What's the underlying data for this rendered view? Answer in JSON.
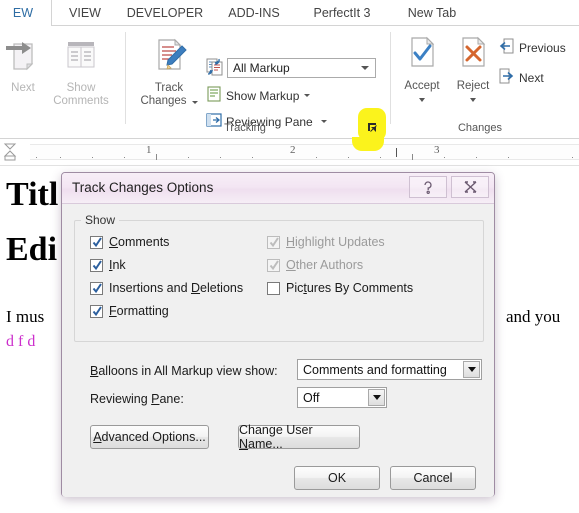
{
  "app": {
    "ribbon_tabs": [
      {
        "label": "EW",
        "active": true
      },
      {
        "label": "VIEW",
        "active": false
      },
      {
        "label": "DEVELOPER",
        "active": false
      },
      {
        "label": "ADD-INS",
        "active": false
      },
      {
        "label": "PerfectIt 3",
        "active": false
      },
      {
        "label": "New Tab",
        "active": false
      }
    ],
    "groups": {
      "comments": {
        "buttons": [
          {
            "label": "Next",
            "icon": "next-comment-icon",
            "disabled": true
          },
          {
            "label": "Show\nComments",
            "line1": "Show",
            "line2": "Comments",
            "icon": "show-comments-icon",
            "disabled": true
          }
        ]
      },
      "tracking": {
        "label": "Tracking",
        "track_changes": {
          "line1": "Track",
          "line2": "Changes",
          "icon": "track-changes-icon",
          "has_dropdown": true
        },
        "display_for_review": {
          "value": "All Markup",
          "icon": "display-for-review-icon"
        },
        "show_markup": {
          "label": "Show Markup",
          "icon": "show-markup-icon",
          "has_dropdown": true
        },
        "reviewing_pane": {
          "label": "Reviewing Pane",
          "icon": "reviewing-pane-icon",
          "has_dropdown": true
        },
        "dialog_launcher": {
          "name": "tracking-dialog-launcher",
          "highlighted": true,
          "highlight_color": "#fbf31c"
        }
      },
      "changes": {
        "label": "Changes",
        "accept": {
          "label": "Accept",
          "icon": "accept-change-icon",
          "accent": "#3b80c4",
          "has_dropdown": true
        },
        "reject": {
          "label": "Reject",
          "icon": "reject-change-icon",
          "accent": "#d5662e",
          "has_dropdown": true
        },
        "previous": {
          "label": "Previous",
          "icon": "previous-change-icon"
        },
        "next": {
          "label": "Next",
          "icon": "next-change-icon"
        }
      }
    }
  },
  "ruler": {
    "numbers": [
      "1",
      "2",
      "3"
    ]
  },
  "document": {
    "heading1": "Titl",
    "heading2": "Edi",
    "body_left": "I mus",
    "body_right": "and you",
    "body_partial": "d f d"
  },
  "dialog": {
    "title": "Track Changes Options",
    "help_button": {
      "name": "help-button",
      "glyph": "?"
    },
    "close_button": {
      "name": "close-button",
      "glyph": "X"
    },
    "show_group": {
      "title": "Show",
      "left_column": [
        {
          "label": "Comments",
          "accel": "C",
          "checked": true,
          "disabled": false
        },
        {
          "label": "Ink",
          "accel": "I",
          "checked": true,
          "disabled": false
        },
        {
          "label": "Insertions and Deletions",
          "accel": "D",
          "checked": true,
          "disabled": false
        },
        {
          "label": "Formatting",
          "accel": "F",
          "checked": true,
          "disabled": false
        }
      ],
      "right_column": [
        {
          "label": "Highlight Updates",
          "accel": "H",
          "checked": true,
          "disabled": true
        },
        {
          "label": "Other Authors",
          "accel": "O",
          "checked": true,
          "disabled": true
        },
        {
          "label": "Pictures By Comments",
          "accel": "t",
          "checked": false,
          "disabled": false
        }
      ]
    },
    "balloons": {
      "label": "Balloons in All Markup view show:",
      "accel": "B",
      "value": "Comments and formatting"
    },
    "reviewing_pane": {
      "label": "Reviewing Pane:",
      "accel": "P",
      "value": "Off"
    },
    "buttons": {
      "advanced_options": {
        "label": "Advanced Options...",
        "accel": "A"
      },
      "change_user_name": {
        "label": "Change User Name...",
        "accel": "N"
      },
      "ok": {
        "label": "OK"
      },
      "cancel": {
        "label": "Cancel"
      }
    }
  }
}
